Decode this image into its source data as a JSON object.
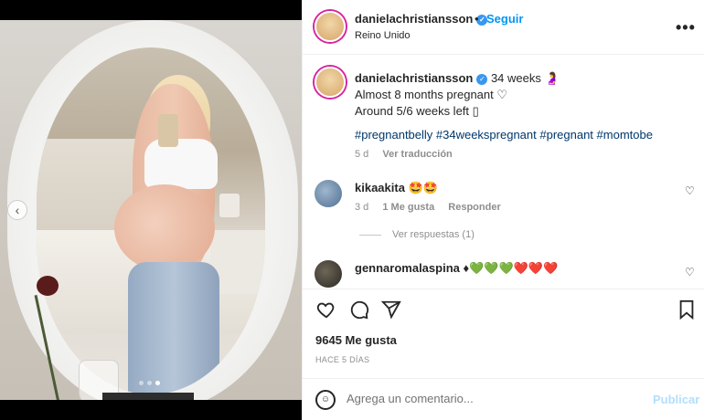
{
  "post": {
    "username": "danielachristiansson",
    "follow_label": "Seguir",
    "separator": "•",
    "location": "Reino Unido",
    "more_label": "•••"
  },
  "caption": {
    "username": "danielachristiansson",
    "text_line1": "34 weeks 🤰",
    "text_line2": "Almost 8 months pregnant ♡",
    "text_line3": "Around 5/6 weeks left ▯",
    "hashtags": "#pregnantbelly #34weekspregnant #pregnant #momtobe",
    "time": "5 d",
    "translate_label": "Ver traducción"
  },
  "comments": [
    {
      "username": "kikaakita",
      "text": "🤩🤩",
      "time": "3 d",
      "likes": "1 Me gusta",
      "reply_label": "Responder",
      "view_replies": "Ver respuestas (1)"
    },
    {
      "username": "gennaromalaspina",
      "text": "♦💚💚💚❤️❤️❤️"
    }
  ],
  "actions": {
    "likes_text": "9645 Me gusta",
    "date_text": "HACE 5 DÍAS"
  },
  "comment_box": {
    "placeholder": "Agrega un comentario...",
    "publish_label": "Publicar"
  },
  "carousel": {
    "slide_count": 3,
    "active_slide": 3
  },
  "colors": {
    "accent": "#0095f6",
    "verified": "#3897f0",
    "hashtag": "#00376b",
    "muted": "#8e8e8e"
  },
  "icons": [
    "heart-icon",
    "comment-icon",
    "share-icon",
    "bookmark-icon",
    "emoji-icon",
    "verified-badge-icon",
    "more-options-icon",
    "chevron-left-icon"
  ]
}
